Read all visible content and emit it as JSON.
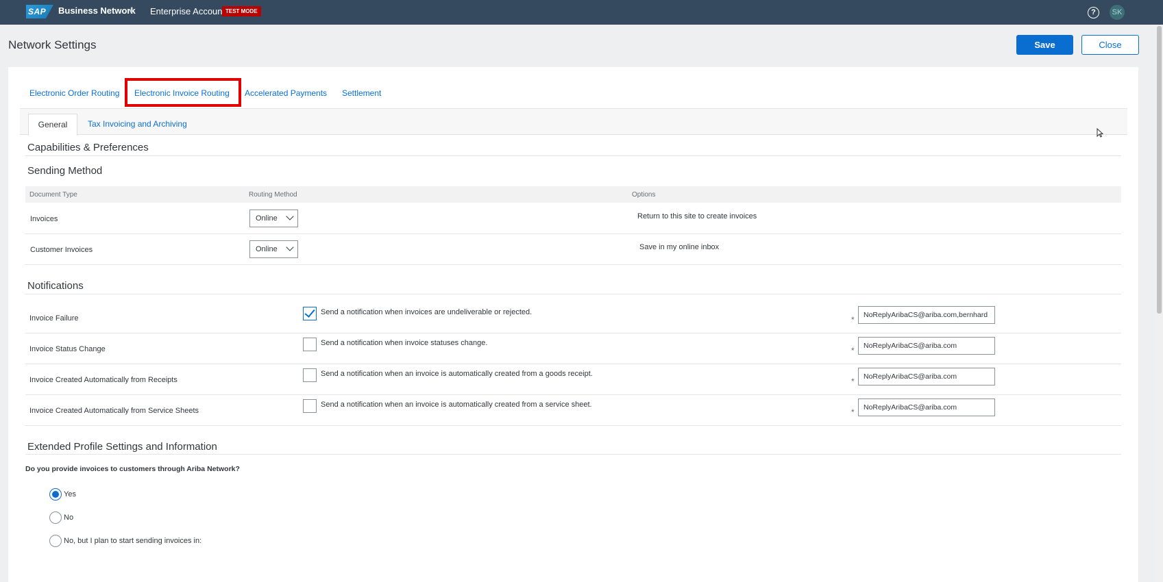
{
  "shell": {
    "logo_text": "SAP",
    "brand": "Business Network",
    "account": "Enterprise Account",
    "test_badge": "TEST MODE",
    "help_glyph": "?",
    "avatar_initials": "SK"
  },
  "page": {
    "title": "Network Settings",
    "save_label": "Save",
    "close_label": "Close"
  },
  "top_tabs": [
    {
      "label": "Electronic Order Routing"
    },
    {
      "label": "Electronic Invoice Routing",
      "highlighted": true
    },
    {
      "label": "Accelerated Payments"
    },
    {
      "label": "Settlement"
    }
  ],
  "sub_tabs": [
    {
      "label": "General",
      "active": true
    },
    {
      "label": "Tax Invoicing and Archiving"
    }
  ],
  "sections": {
    "capabilities": "Capabilities & Preferences",
    "sending_method": "Sending Method",
    "notifications": "Notifications",
    "extended": "Extended Profile Settings and Information"
  },
  "sending_table": {
    "headers": [
      "Document Type",
      "Routing Method",
      "Options"
    ],
    "rows": [
      {
        "doc_type": "Invoices",
        "routing": "Online",
        "option": "Return to this site to create invoices"
      },
      {
        "doc_type": "Customer Invoices",
        "routing": "Online",
        "option": "Save in my online inbox"
      }
    ]
  },
  "notifications": [
    {
      "label": "Invoice Failure",
      "checked": true,
      "text": "Send a notification when invoices are undeliverable or rejected.",
      "email": "NoReplyAribaCS@ariba.com,bernhard"
    },
    {
      "label": "Invoice Status Change",
      "checked": false,
      "text": "Send a notification when invoice statuses change.",
      "email": "NoReplyAribaCS@ariba.com"
    },
    {
      "label": "Invoice Created Automatically from Receipts",
      "checked": false,
      "text": "Send a notification when an invoice is automatically created from a goods receipt.",
      "email": "NoReplyAribaCS@ariba.com"
    },
    {
      "label": "Invoice Created Automatically from Service Sheets",
      "checked": false,
      "text": "Send a notification when an invoice is automatically created from a service sheet.",
      "email": "NoReplyAribaCS@ariba.com"
    }
  ],
  "required_marker": "*",
  "extended": {
    "question": "Do you provide invoices to customers through Ariba Network?",
    "options": [
      {
        "label": "Yes",
        "selected": true
      },
      {
        "label": "No",
        "selected": false
      },
      {
        "label": "No, but I plan to start sending invoices in:",
        "selected": false
      }
    ]
  },
  "colors": {
    "shell": "#354a5f",
    "accent": "#0a6ed1",
    "highlight": "#e00000",
    "badge": "#bb0000"
  }
}
